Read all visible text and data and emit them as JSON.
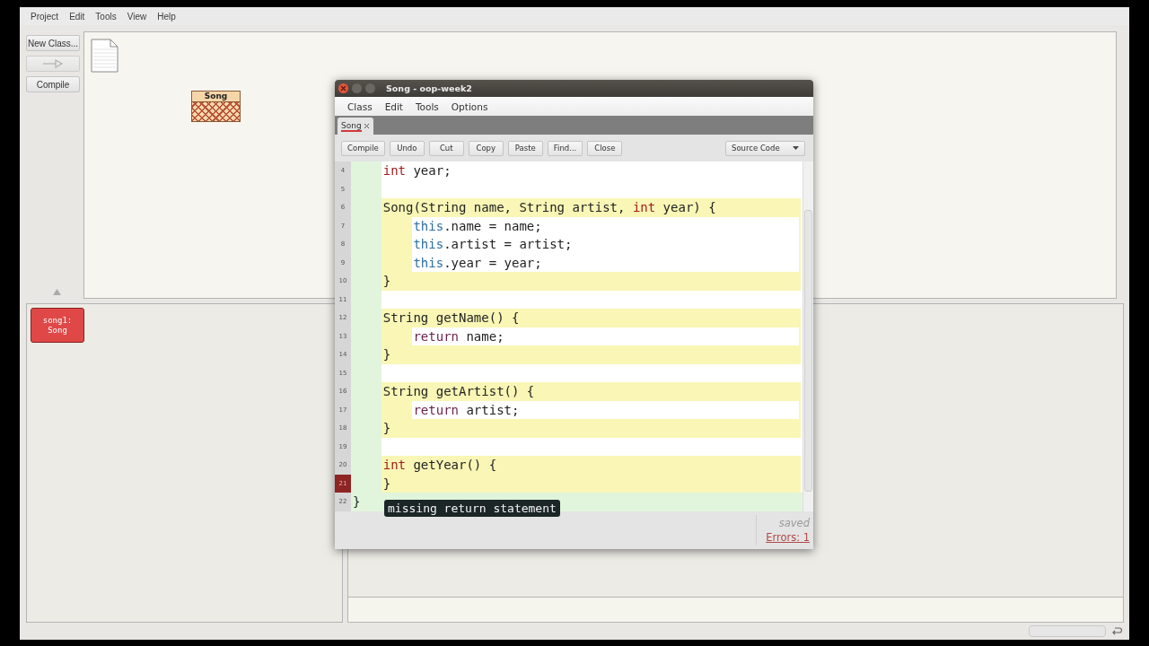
{
  "main_menu": [
    "Project",
    "Edit",
    "Tools",
    "View",
    "Help"
  ],
  "tool_buttons": [
    {
      "kind": "button",
      "label": "New Class..."
    },
    {
      "kind": "arrow"
    },
    {
      "kind": "button",
      "label": "Compile"
    }
  ],
  "diagram": {
    "classes": [
      {
        "name": "Song",
        "compiled": false
      }
    ]
  },
  "object_bench": [
    {
      "name": "song1:",
      "type": "Song"
    }
  ],
  "editor": {
    "title": "Song - oop-week2",
    "menu": [
      "Class",
      "Edit",
      "Tools",
      "Options"
    ],
    "tabs": [
      {
        "label": "Song",
        "selected": true
      }
    ],
    "toolbar": [
      "Compile",
      "Undo",
      "Cut",
      "Copy",
      "Paste",
      "Find...",
      "Close"
    ],
    "view": "Source Code",
    "lines": [
      {
        "number": "4",
        "kind": "class",
        "error": false,
        "tokens": [
          {
            "kind": "keyword",
            "text": "    int"
          },
          {
            "kind": "plain",
            "text": " year;"
          }
        ]
      },
      {
        "number": "5",
        "kind": "class",
        "error": false
      },
      {
        "number": "6",
        "kind": "method",
        "error": false,
        "tokens": [
          {
            "kind": "plain",
            "text": "    Song(String name, String artist, "
          },
          {
            "kind": "keyword",
            "text": "int"
          },
          {
            "kind": "plain",
            "text": " year) {"
          }
        ]
      },
      {
        "number": "7",
        "kind": "body",
        "error": false,
        "tokens": [
          {
            "kind": "this",
            "text": "        this"
          },
          {
            "kind": "plain",
            "text": ".name = name;"
          }
        ]
      },
      {
        "number": "8",
        "kind": "body",
        "error": false,
        "tokens": [
          {
            "kind": "this",
            "text": "        this"
          },
          {
            "kind": "plain",
            "text": ".artist = artist;"
          }
        ]
      },
      {
        "number": "9",
        "kind": "body",
        "error": false,
        "tokens": [
          {
            "kind": "this",
            "text": "        this"
          },
          {
            "kind": "plain",
            "text": ".year = year;"
          }
        ]
      },
      {
        "number": "10",
        "kind": "method",
        "error": false,
        "tokens": [
          {
            "kind": "plain",
            "text": "    }"
          }
        ]
      },
      {
        "number": "11",
        "kind": "class",
        "error": false
      },
      {
        "number": "12",
        "kind": "method",
        "error": false,
        "tokens": [
          {
            "kind": "plain",
            "text": "    String getName() {"
          }
        ]
      },
      {
        "number": "13",
        "kind": "body",
        "error": false,
        "tokens": [
          {
            "kind": "return",
            "text": "        return"
          },
          {
            "kind": "plain",
            "text": " name;"
          }
        ]
      },
      {
        "number": "14",
        "kind": "method",
        "error": false,
        "tokens": [
          {
            "kind": "plain",
            "text": "    }"
          }
        ]
      },
      {
        "number": "15",
        "kind": "class",
        "error": false
      },
      {
        "number": "16",
        "kind": "method",
        "error": false,
        "tokens": [
          {
            "kind": "plain",
            "text": "    String getArtist() {"
          }
        ]
      },
      {
        "number": "17",
        "kind": "body",
        "error": false,
        "tokens": [
          {
            "kind": "return",
            "text": "        return"
          },
          {
            "kind": "plain",
            "text": " artist;"
          }
        ]
      },
      {
        "number": "18",
        "kind": "method",
        "error": false,
        "tokens": [
          {
            "kind": "plain",
            "text": "    }"
          }
        ]
      },
      {
        "number": "19",
        "kind": "class",
        "error": false
      },
      {
        "number": "20",
        "kind": "method",
        "error": false,
        "tokens": [
          {
            "kind": "keyword",
            "text": "    int"
          },
          {
            "kind": "plain",
            "text": " getYear() {"
          }
        ]
      },
      {
        "number": "21",
        "kind": "method",
        "error": true,
        "tokens": [
          {
            "kind": "plain",
            "text": "    }"
          }
        ]
      },
      {
        "number": "22",
        "kind": "class-end",
        "error": false,
        "tokens": [
          {
            "kind": "plain",
            "text": "}"
          }
        ]
      }
    ],
    "tooltip": "missing return statement",
    "status": "saved",
    "errors": "Errors: 1"
  }
}
